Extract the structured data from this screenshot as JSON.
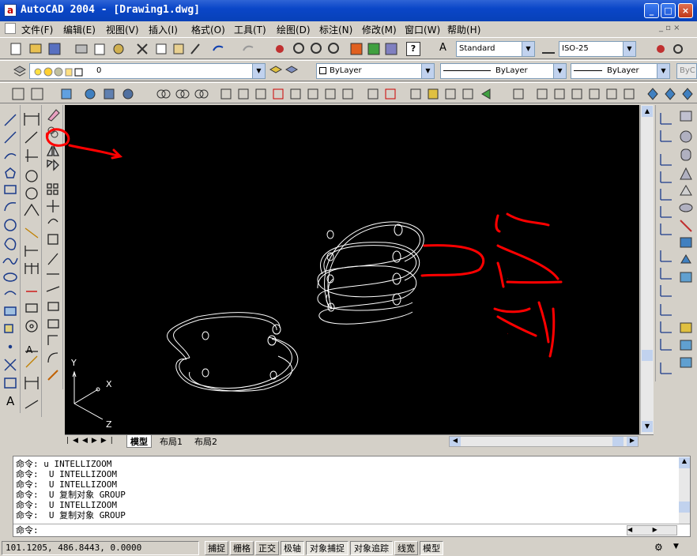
{
  "window": {
    "title": "AutoCAD 2004 - [Drawing1.dwg]",
    "app_icon_letter": "a",
    "buttons": [
      "_",
      "□",
      "×"
    ]
  },
  "menu": {
    "items": [
      "文件(F)",
      "编辑(E)",
      "视图(V)",
      "插入(I)",
      "格式(O)",
      "工具(T)",
      "绘图(D)",
      "标注(N)",
      "修改(M)",
      "窗口(W)",
      "帮助(H)"
    ]
  },
  "toolbar": {
    "text_style": "Standard",
    "dim_style": "ISO-25",
    "layer": "0",
    "color": "ByLayer",
    "linetype": "ByLayer",
    "lineweight": "ByLayer",
    "plotstyle": "ByC"
  },
  "tabs": [
    "模型",
    "布局1",
    "布局2"
  ],
  "annotations": {
    "copy_label_1": "复",
    "copy_label_2": "制"
  },
  "ucs": {
    "x": "X",
    "y": "Y",
    "z": "Z"
  },
  "command": {
    "history": [
      "命令: u INTELLIZOOM",
      "命令:  U INTELLIZOOM",
      "命令:  U INTELLIZOOM",
      "命令:  U 复制对象 GROUP",
      "命令:  U INTELLIZOOM",
      "命令:  U 复制对象 GROUP"
    ],
    "prompt": "命令:"
  },
  "status": {
    "coords": "101.1205, 486.8443, 0.0000",
    "toggles": [
      {
        "label": "捕捉",
        "on": false
      },
      {
        "label": "栅格",
        "on": false
      },
      {
        "label": "正交",
        "on": false
      },
      {
        "label": "极轴",
        "on": true
      },
      {
        "label": "对象捕捉",
        "on": true
      },
      {
        "label": "对象追踪",
        "on": true
      },
      {
        "label": "线宽",
        "on": false
      },
      {
        "label": "模型",
        "on": true
      }
    ]
  },
  "colors": {
    "title_blue": "#0a46c8",
    "canvas_bg": "#000000",
    "annotation_red": "#ff0000"
  }
}
